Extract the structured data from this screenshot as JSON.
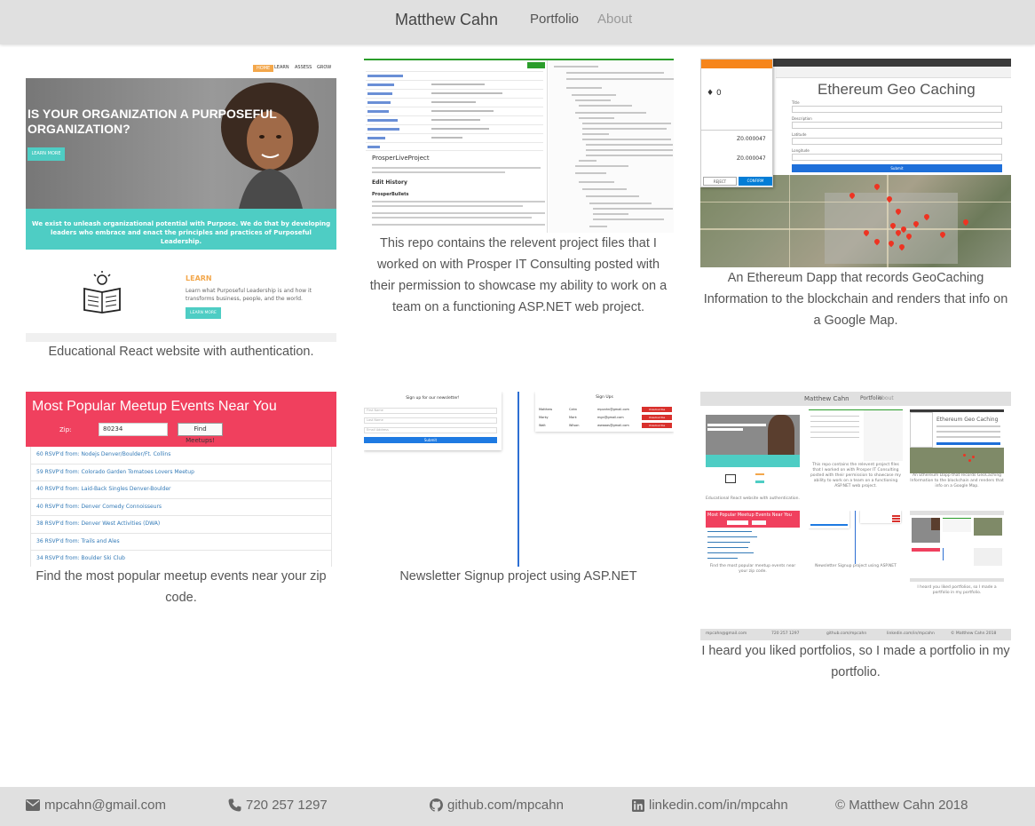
{
  "navbar": {
    "brand": "Matthew Cahn",
    "links": [
      {
        "label": "Portfolio"
      },
      {
        "label": "About"
      }
    ]
  },
  "projects": [
    {
      "caption": "Educational React website with authentication.",
      "preview": {
        "nav_items": [
          "HOME",
          "LEARN",
          "ASSESS",
          "GROW"
        ],
        "hero_title": "IS YOUR ORGANIZATION A PURPOSEFUL ORGANIZATION?",
        "hero_button": "LEARN MORE",
        "band_text": "We exist to unleash organizational potential with Purpose. We do that by developing leaders who embrace and enact the principles and practices of Purposeful Leadership.",
        "learn_title": "LEARN",
        "learn_text": "Learn what Purposeful Leadership is and how it transforms business, people, and the world.",
        "learn_button": "LEARN MORE"
      }
    },
    {
      "caption": "This repo contains the relevent project files that I worked on with Prosper IT Consulting posted with their permission to showcase my ability to work on a team on a functioning ASP.NET web project.",
      "preview": {
        "project_title": "ProsperLiveProject",
        "edit_history": "Edit History",
        "sub_heading": "ProsperBullets"
      }
    },
    {
      "caption": "An Ethereum Dapp that records GeoCaching Information to the blockchain and renders that info on a Google Map.",
      "preview": {
        "title": "Ethereum Geo Caching",
        "balance": "0",
        "amount": "Ζ0.000047",
        "amount2": "Ζ0.000047",
        "reject": "REJECT",
        "confirm": "CONFIRM",
        "submit": "Submit",
        "fields": [
          "Title",
          "Description",
          "Latitude",
          "Longitude"
        ]
      }
    },
    {
      "caption": "Find the most popular meetup events near your zip code.",
      "preview": {
        "title": "Most Popular Meetup Events Near You",
        "zip_label": "Zip:",
        "zip_value": "80234",
        "button": "Find Meetups!",
        "items": [
          "60 RSVP'd from: Nodejs Denver/Boulder/Ft. Collins",
          "59 RSVP'd from: Colorado Garden Tomatoes Lovers Meetup",
          "40 RSVP'd from: Laid-Back Singles Denver-Boulder",
          "40 RSVP'd from: Denver Comedy Connoisseurs",
          "38 RSVP'd from: Denver West Activities (DWA)",
          "36 RSVP'd from: Trails and Ales",
          "34 RSVP'd from: Boulder Ski Club"
        ]
      }
    },
    {
      "caption": "Newsletter Signup project using ASP.NET",
      "preview": {
        "form_title": "Sign up for our newsletter!",
        "fields": [
          "First Name",
          "Last Name",
          "Email Address"
        ],
        "button": "Submit",
        "table_title": "Sign Ups",
        "rows": [
          [
            "Matthew",
            "Cahn",
            "mpcahn@gmail.com"
          ],
          [
            "Marky",
            "Mark",
            "mgn@gmail.com"
          ],
          [
            "Walt",
            "Wilson",
            "wwaaas@gmail.com"
          ]
        ],
        "delete": "Unsubscribe"
      }
    },
    {
      "caption": "I heard you liked portfolios, so I made a portfolio in my portfolio.",
      "preview": {
        "brand": "Matthew Cahn",
        "links": [
          "Portfolio",
          "About"
        ],
        "mini_captions": [
          "Educational React website with authentication.",
          "This repo contains the relevent project files that I worked on with Prosper IT Consulting posted with their permission to showcase my ability to work on a team on a functioning ASP.NET web project.",
          "An Ethereum Dapp that records GeoCaching Information to the blockchain and renders that info on a Google Map.",
          "Find the most popular meetup events near your zip code.",
          "Newsletter Signup project using ASP.NET",
          "I heard you liked portfolios, so I made a portfolio in my portfolio."
        ],
        "footer": [
          "mpcahn@gmail.com",
          "720 257 1297",
          "github.com/mpcahn",
          "linkedin.com/in/mpcahn",
          "© Matthew Cahn 2018"
        ]
      }
    }
  ],
  "footer": {
    "email": "mpcahn@gmail.com",
    "phone": "720 257 1297",
    "github": "github.com/mpcahn",
    "linkedin": "linkedin.com/in/mpcahn",
    "copyright": "© Matthew Cahn 2018"
  },
  "colors": {
    "navbar_bg": "#e0e0e0",
    "teal": "#4ecdc4",
    "orange": "#f3a74b",
    "meetup_red": "#f0405e",
    "link_blue": "#337ab7"
  },
  "icons": {
    "email": "envelope-icon",
    "phone": "phone-icon",
    "github": "github-icon",
    "linkedin": "linkedin-icon"
  }
}
